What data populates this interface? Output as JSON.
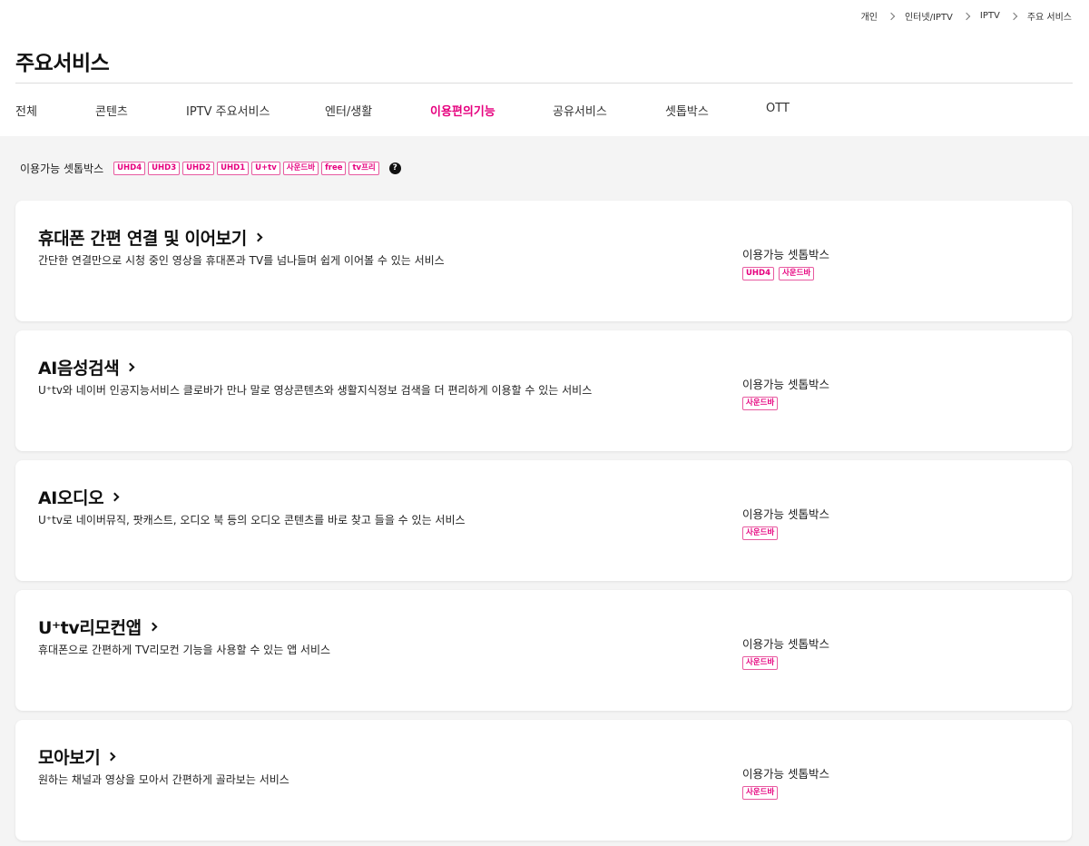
{
  "breadcrumb": [
    "개인",
    "인터넷/IPTV",
    "IPTV",
    "주요 서비스"
  ],
  "page_title": "주요서비스",
  "tabs": [
    {
      "label": "전체",
      "active": false
    },
    {
      "label": "콘텐츠",
      "active": false
    },
    {
      "label": "IPTV 주요서비스",
      "active": false
    },
    {
      "label": "엔터/생활",
      "active": false
    },
    {
      "label": "이용편의기능",
      "active": true
    },
    {
      "label": "공유서비스",
      "active": false
    },
    {
      "label": "셋톱박스",
      "active": false
    },
    {
      "label": "OTT",
      "active": false
    }
  ],
  "filter": {
    "label": "이용가능 셋톱박스",
    "badges": [
      "UHD4",
      "UHD3",
      "UHD2",
      "UHD1",
      "U+tv",
      "사운드바",
      "free",
      "tv프리"
    ],
    "help": "?"
  },
  "cards": [
    {
      "title": "휴대폰 간편 연결 및 이어보기",
      "desc": "간단한 연결만으로 시청 중인 영상을 휴대폰과 TV를 넘나들며 쉽게 이어볼 수 있는 서비스",
      "avail_label": "이용가능 셋톱박스",
      "badges": [
        "UHD4",
        "사운드바"
      ]
    },
    {
      "title": "AI음성검색",
      "desc": "U⁺tv와 네이버 인공지능서비스 클로바가 만나 말로 영상콘텐츠와 생활지식정보 검색을 더 편리하게 이용할 수 있는 서비스",
      "avail_label": "이용가능 셋톱박스",
      "badges": [
        "사운드바"
      ]
    },
    {
      "title": "AI오디오",
      "desc": "U⁺tv로 네이버뮤직, 팟캐스트, 오디오 북 등의 오디오 콘텐츠를 바로 찾고 들을 수 있는 서비스",
      "avail_label": "이용가능 셋톱박스",
      "badges": [
        "사운드바"
      ]
    },
    {
      "title": "U⁺tv리모컨앱",
      "desc": "휴대폰으로 간편하게 TV리모컨 기능을 사용할 수 있는 앱 서비스",
      "avail_label": "이용가능 셋톱박스",
      "badges": [
        "사운드바"
      ]
    },
    {
      "title": "모아보기",
      "desc": "원하는 채널과 영상을 모아서 간편하게 골라보는 서비스",
      "avail_label": "이용가능 셋톱박스",
      "badges": [
        "사운드바"
      ]
    }
  ],
  "colors": {
    "accent": "#e6007e",
    "background": "#f4f4f4",
    "card": "#ffffff"
  }
}
